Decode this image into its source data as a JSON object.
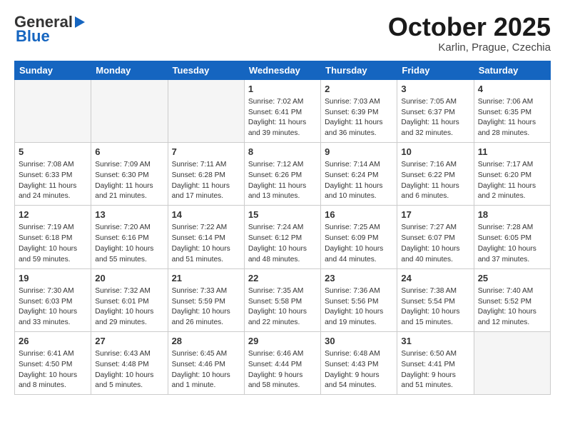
{
  "header": {
    "logo_general": "General",
    "logo_blue": "Blue",
    "month": "October 2025",
    "location": "Karlin, Prague, Czechia"
  },
  "days_of_week": [
    "Sunday",
    "Monday",
    "Tuesday",
    "Wednesday",
    "Thursday",
    "Friday",
    "Saturday"
  ],
  "weeks": [
    [
      {
        "day": "",
        "info": ""
      },
      {
        "day": "",
        "info": ""
      },
      {
        "day": "",
        "info": ""
      },
      {
        "day": "1",
        "info": "Sunrise: 7:02 AM\nSunset: 6:41 PM\nDaylight: 11 hours\nand 39 minutes."
      },
      {
        "day": "2",
        "info": "Sunrise: 7:03 AM\nSunset: 6:39 PM\nDaylight: 11 hours\nand 36 minutes."
      },
      {
        "day": "3",
        "info": "Sunrise: 7:05 AM\nSunset: 6:37 PM\nDaylight: 11 hours\nand 32 minutes."
      },
      {
        "day": "4",
        "info": "Sunrise: 7:06 AM\nSunset: 6:35 PM\nDaylight: 11 hours\nand 28 minutes."
      }
    ],
    [
      {
        "day": "5",
        "info": "Sunrise: 7:08 AM\nSunset: 6:33 PM\nDaylight: 11 hours\nand 24 minutes."
      },
      {
        "day": "6",
        "info": "Sunrise: 7:09 AM\nSunset: 6:30 PM\nDaylight: 11 hours\nand 21 minutes."
      },
      {
        "day": "7",
        "info": "Sunrise: 7:11 AM\nSunset: 6:28 PM\nDaylight: 11 hours\nand 17 minutes."
      },
      {
        "day": "8",
        "info": "Sunrise: 7:12 AM\nSunset: 6:26 PM\nDaylight: 11 hours\nand 13 minutes."
      },
      {
        "day": "9",
        "info": "Sunrise: 7:14 AM\nSunset: 6:24 PM\nDaylight: 11 hours\nand 10 minutes."
      },
      {
        "day": "10",
        "info": "Sunrise: 7:16 AM\nSunset: 6:22 PM\nDaylight: 11 hours\nand 6 minutes."
      },
      {
        "day": "11",
        "info": "Sunrise: 7:17 AM\nSunset: 6:20 PM\nDaylight: 11 hours\nand 2 minutes."
      }
    ],
    [
      {
        "day": "12",
        "info": "Sunrise: 7:19 AM\nSunset: 6:18 PM\nDaylight: 10 hours\nand 59 minutes."
      },
      {
        "day": "13",
        "info": "Sunrise: 7:20 AM\nSunset: 6:16 PM\nDaylight: 10 hours\nand 55 minutes."
      },
      {
        "day": "14",
        "info": "Sunrise: 7:22 AM\nSunset: 6:14 PM\nDaylight: 10 hours\nand 51 minutes."
      },
      {
        "day": "15",
        "info": "Sunrise: 7:24 AM\nSunset: 6:12 PM\nDaylight: 10 hours\nand 48 minutes."
      },
      {
        "day": "16",
        "info": "Sunrise: 7:25 AM\nSunset: 6:09 PM\nDaylight: 10 hours\nand 44 minutes."
      },
      {
        "day": "17",
        "info": "Sunrise: 7:27 AM\nSunset: 6:07 PM\nDaylight: 10 hours\nand 40 minutes."
      },
      {
        "day": "18",
        "info": "Sunrise: 7:28 AM\nSunset: 6:05 PM\nDaylight: 10 hours\nand 37 minutes."
      }
    ],
    [
      {
        "day": "19",
        "info": "Sunrise: 7:30 AM\nSunset: 6:03 PM\nDaylight: 10 hours\nand 33 minutes."
      },
      {
        "day": "20",
        "info": "Sunrise: 7:32 AM\nSunset: 6:01 PM\nDaylight: 10 hours\nand 29 minutes."
      },
      {
        "day": "21",
        "info": "Sunrise: 7:33 AM\nSunset: 5:59 PM\nDaylight: 10 hours\nand 26 minutes."
      },
      {
        "day": "22",
        "info": "Sunrise: 7:35 AM\nSunset: 5:58 PM\nDaylight: 10 hours\nand 22 minutes."
      },
      {
        "day": "23",
        "info": "Sunrise: 7:36 AM\nSunset: 5:56 PM\nDaylight: 10 hours\nand 19 minutes."
      },
      {
        "day": "24",
        "info": "Sunrise: 7:38 AM\nSunset: 5:54 PM\nDaylight: 10 hours\nand 15 minutes."
      },
      {
        "day": "25",
        "info": "Sunrise: 7:40 AM\nSunset: 5:52 PM\nDaylight: 10 hours\nand 12 minutes."
      }
    ],
    [
      {
        "day": "26",
        "info": "Sunrise: 6:41 AM\nSunset: 4:50 PM\nDaylight: 10 hours\nand 8 minutes."
      },
      {
        "day": "27",
        "info": "Sunrise: 6:43 AM\nSunset: 4:48 PM\nDaylight: 10 hours\nand 5 minutes."
      },
      {
        "day": "28",
        "info": "Sunrise: 6:45 AM\nSunset: 4:46 PM\nDaylight: 10 hours\nand 1 minute."
      },
      {
        "day": "29",
        "info": "Sunrise: 6:46 AM\nSunset: 4:44 PM\nDaylight: 9 hours\nand 58 minutes."
      },
      {
        "day": "30",
        "info": "Sunrise: 6:48 AM\nSunset: 4:43 PM\nDaylight: 9 hours\nand 54 minutes."
      },
      {
        "day": "31",
        "info": "Sunrise: 6:50 AM\nSunset: 4:41 PM\nDaylight: 9 hours\nand 51 minutes."
      },
      {
        "day": "",
        "info": ""
      }
    ]
  ]
}
